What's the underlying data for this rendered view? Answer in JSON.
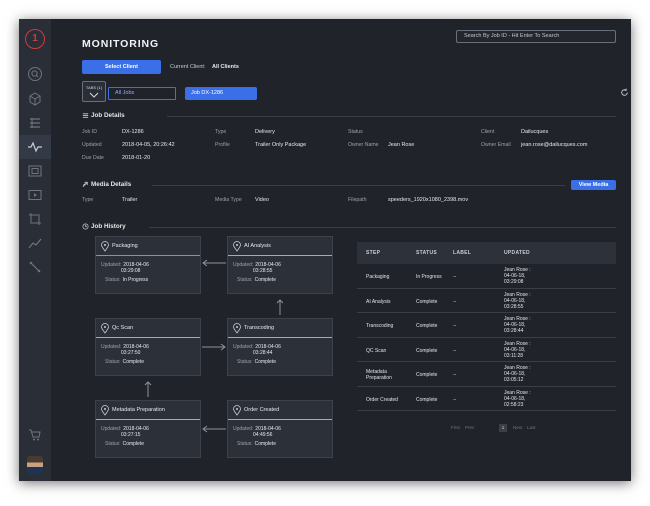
{
  "app": {
    "title": "MONITORING",
    "logo": "1",
    "search_placeholder": "Search By Job ID - Hit Enter To Search"
  },
  "sidebar": {
    "icons": [
      "search-icon",
      "cube-icon",
      "list-icon",
      "pulse-icon",
      "film-icon",
      "play-icon",
      "crop-icon",
      "chart-icon",
      "tools-icon",
      "cart-icon"
    ],
    "active": "pulse-icon"
  },
  "client": {
    "select_label": "Select Client",
    "current_label": "Current Client:",
    "current_value": "All Clients"
  },
  "tabs": {
    "toggle_label": "TABS (1)",
    "items": [
      {
        "label": "All Jobs",
        "active": false
      },
      {
        "label": "Job DX-1286",
        "active": true
      }
    ]
  },
  "job_details": {
    "title": "Job Details",
    "job_id_label": "Job ID",
    "job_id": "DX-1286",
    "updated_label": "Updated",
    "updated": "2018-04-05, 20:26:42",
    "due_label": "Due Date",
    "due": "2018-01-20",
    "type_label": "Type",
    "type": "Delivery",
    "profile_label": "Profile",
    "profile": "Trailer Only Package",
    "status_label": "Status",
    "status": "",
    "owner_label": "Owner Name",
    "owner": "Jean Rose",
    "client_label": "Client",
    "client": "Dailucques",
    "email_label": "Owner Email",
    "email": "jean.rose@dailucques.com"
  },
  "media_details": {
    "title": "Media Details",
    "view_button": "View Media",
    "type_label": "Type",
    "type": "Trailer",
    "media_type_label": "Media Type",
    "media_type": "Video",
    "filepath_label": "Filepath",
    "filepath": "speeders_1920x1080_2398.mov"
  },
  "job_history": {
    "title": "Job History",
    "nodes": [
      {
        "title": "Packaging",
        "updated_label": "Updated:",
        "date": "2018-04-06",
        "time": "03:29:08",
        "status_label": "Status:",
        "status": "In Progress",
        "status_color": "#8d929c"
      },
      {
        "title": "AI Analysis",
        "updated_label": "Updated:",
        "date": "2018-04-06",
        "time": "03:28:55",
        "status_label": "Status:",
        "status": "Complete",
        "status_color": "#8ccf3a"
      },
      {
        "title": "Qc Scan",
        "updated_label": "Updated:",
        "date": "2018-04-06",
        "time": "03:27:50",
        "status_label": "Status:",
        "status": "Complete",
        "status_color": "#8ccf3a"
      },
      {
        "title": "Transcoding",
        "updated_label": "Updated:",
        "date": "2018-04-06",
        "time": "03:28:44",
        "status_label": "Status:",
        "status": "Complete",
        "status_color": "#8ccf3a"
      },
      {
        "title": "Metadata Preparation",
        "updated_label": "Updated:",
        "date": "2018-04-06",
        "time": "03:27:15",
        "status_label": "Status:",
        "status": "Complete",
        "status_color": "#8ccf3a"
      },
      {
        "title": "Order Created",
        "updated_label": "Updated:",
        "date": "2018-04-06",
        "time": "04:49:56",
        "status_label": "Status:",
        "status": "Complete",
        "status_color": "#8ccf3a"
      }
    ],
    "table": {
      "headers": [
        "STEP",
        "STATUS",
        "LABEL",
        "UPDATED"
      ],
      "rows": [
        {
          "step": "Packaging",
          "status": "In Progress",
          "label": "--",
          "updated": [
            "Jean Rose :",
            "04-06-18,",
            "03:29:08"
          ]
        },
        {
          "step": "AI Analysis",
          "status": "Complete",
          "label": "--",
          "updated": [
            "Jean Rose :",
            "04-06-18,",
            "03:28:55"
          ]
        },
        {
          "step": "Transcoding",
          "status": "Complete",
          "label": "--",
          "updated": [
            "Jean Rose :",
            "04-06-18,",
            "03:28:44"
          ]
        },
        {
          "step": "QC Scan",
          "status": "Complete",
          "label": "--",
          "updated": [
            "Jean Rose :",
            "04-06-18,",
            "03:11:28"
          ]
        },
        {
          "step": "Metadata Preparation",
          "status": "Complete",
          "label": "--",
          "updated": [
            "Jean Rose :",
            "04-06-18,",
            "03:05:12"
          ]
        },
        {
          "step": "Order Created",
          "status": "Complete",
          "label": "--",
          "updated": [
            "Jean Rose :",
            "04-06-18,",
            "02:58:23"
          ]
        }
      ]
    },
    "pager": {
      "first": "First",
      "prev": "Prev",
      "current": "1",
      "next": "Next",
      "last": "Last"
    }
  },
  "colors": {
    "accent": "#3b6fe8",
    "complete": "#8ccf3a",
    "logo": "#d13b3b",
    "background": "#20232a"
  }
}
